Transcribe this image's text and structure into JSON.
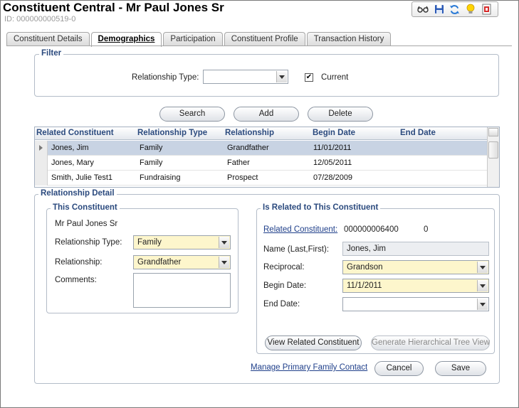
{
  "header": {
    "title": "Constituent Central - Mr Paul Jones Sr",
    "id_label": "ID: 000000000519-0"
  },
  "toolbar": {
    "icons": [
      "glasses-icon",
      "save-icon",
      "refresh-icon",
      "lightbulb-icon",
      "report-icon"
    ]
  },
  "tabs": [
    {
      "label": "Constituent Details"
    },
    {
      "label": "Demographics",
      "active": true
    },
    {
      "label": "Participation"
    },
    {
      "label": "Constituent Profile"
    },
    {
      "label": "Transaction History"
    }
  ],
  "filter": {
    "legend": "Filter",
    "relationship_type_label": "Relationship Type:",
    "relationship_type_value": "",
    "current_label": "Current",
    "current_checked": true
  },
  "actions": {
    "search": "Search",
    "add": "Add",
    "delete": "Delete"
  },
  "grid": {
    "columns": [
      "Related Constituent",
      "Relationship Type",
      "Relationship",
      "Begin Date",
      "End Date"
    ],
    "rows": [
      {
        "constituent": "Jones, Jim",
        "type": "Family",
        "relationship": "Grandfather",
        "begin": "11/01/2011",
        "end": ""
      },
      {
        "constituent": "Jones, Mary",
        "type": "Family",
        "relationship": "Father",
        "begin": "12/05/2011",
        "end": ""
      },
      {
        "constituent": "Smith, Julie Test1",
        "type": "Fundraising",
        "relationship": "Prospect",
        "begin": "07/28/2009",
        "end": ""
      }
    ]
  },
  "detail": {
    "legend": "Relationship Detail",
    "this_constituent": {
      "legend": "This Constituent",
      "name": "Mr Paul Jones Sr",
      "relationship_type_label": "Relationship Type:",
      "relationship_type_value": "Family",
      "relationship_label": "Relationship:",
      "relationship_value": "Grandfather",
      "comments_label": "Comments:"
    },
    "related": {
      "legend": "Is Related to This Constituent",
      "related_constituent_label": "Related Constituent:",
      "related_constituent_id": "000000006400",
      "related_constituent_suffix": "0",
      "name_label": "Name (Last,First):",
      "name_value": "Jones, Jim",
      "reciprocal_label": "Reciprocal:",
      "reciprocal_value": "Grandson",
      "begin_date_label": "Begin Date:",
      "begin_date_value": "11/1/2011",
      "end_date_label": "End Date:",
      "end_date_value": "",
      "view_button": "View Related Constituent",
      "tree_button": "Generate Hierarchical Tree View"
    },
    "manage_link": "Manage Primary Family Contact",
    "cancel": "Cancel",
    "save": "Save"
  }
}
